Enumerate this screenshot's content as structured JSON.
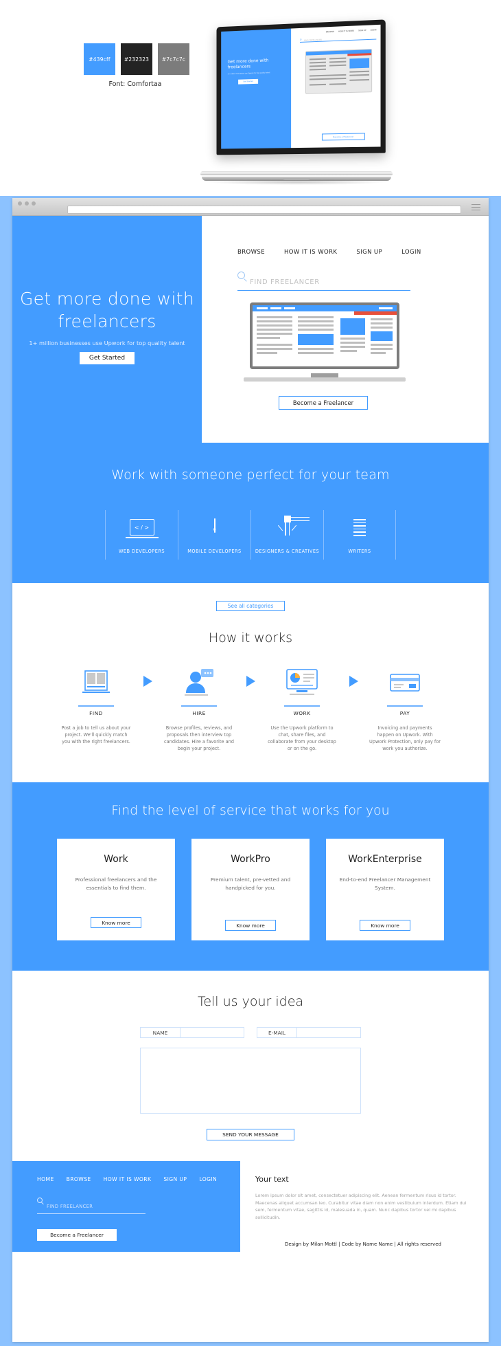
{
  "brand": {
    "swatches": [
      {
        "hex": "#439cff",
        "label": "#439cff",
        "text_color": "#ffffff"
      },
      {
        "hex": "#232323",
        "label": "#232323",
        "text_color": "#ffffff"
      },
      {
        "hex": "#7c7c7c",
        "label": "#7c7c7c",
        "text_color": "#ffffff"
      }
    ],
    "font_note": "Font: Comfortaa"
  },
  "mockup": {
    "nav": [
      "BROWSE",
      "HOW IT IS WORK",
      "SIGN UP",
      "LOGIN"
    ],
    "search_placeholder": "FIND FREELANCER",
    "headline": "Get more done with freelancers",
    "subhead": "1+ million businesses use Upwork for top quality talent",
    "cta": "Get Started",
    "become": "Become a Freelancer"
  },
  "browser": {
    "url_value": ""
  },
  "hero": {
    "nav": [
      "BROWSE",
      "HOW IT IS WORK",
      "SIGN UP",
      "LOGIN"
    ],
    "search_placeholder": "FIND FREELANCER",
    "headline": "Get more done with freelancers",
    "subhead": "1+ million businesses use Upwork for top quality talent",
    "cta": "Get Started",
    "become_freelancer": "Become a Freelancer"
  },
  "categories": {
    "title": "Work with someone perfect for your team",
    "items": [
      {
        "label": "WEB DEVELOPERS",
        "icon": "laptop-code-icon"
      },
      {
        "label": "MOBILE DEVELOPERS",
        "icon": "mobile-phone-icon"
      },
      {
        "label": "DESIGNERS & CREATIVES",
        "icon": "vector-nodes-icon"
      },
      {
        "label": "WRITERS",
        "icon": "document-lines-icon"
      }
    ],
    "see_all": "See all categories"
  },
  "how_it_works": {
    "title": "How it works",
    "steps": [
      {
        "name": "FIND",
        "icon": "job-post-icon",
        "desc": "Post a job to tell us about your project. We'll quickly match you with the right freelancers."
      },
      {
        "name": "HIRE",
        "icon": "profile-chat-icon",
        "desc": "Browse profiles, reviews, and proposals then interview top candidates. Hire a favorite and begin your project."
      },
      {
        "name": "WORK",
        "icon": "monitor-dashboard-icon",
        "desc": "Use the Upwork platform to chat, share files, and collaborate from your desktop or on the go."
      },
      {
        "name": "PAY",
        "icon": "credit-card-icon",
        "desc": "Invoicing and payments happen on Upwork. With Upwork Protection, only pay for work you authorize."
      }
    ]
  },
  "levels": {
    "title": "Find the level of service that works for you",
    "cards": [
      {
        "name": "Work",
        "desc": "Professional freelancers and the essentials to find them.",
        "button": "Know more"
      },
      {
        "name": "WorkPro",
        "desc": "Premium talent, pre-vetted and handpicked for you.",
        "button": "Know more"
      },
      {
        "name": "WorkEnterprise",
        "desc": "End-to-end Freelancer Management System.",
        "button": "Know more"
      }
    ]
  },
  "contact": {
    "title": "Tell us your idea",
    "name_label": "NAME",
    "name_value": "",
    "email_label": "E-MAIL",
    "email_value": "",
    "message_value": "",
    "send_button": "SEND YOUR MESSAGE"
  },
  "footer": {
    "nav": [
      "HOME",
      "BROWSE",
      "HOW IT IS WORK",
      "SIGN UP",
      "LOGIN"
    ],
    "search_placeholder": "FIND FREELANCER",
    "become_freelancer": "Become a Freelancer",
    "right_title": "Your text",
    "right_text": "Lorem ipsum dolor sit amet, consectetuer adipiscing elit. Aenean fermentum risus id tortor. Maecenas aliquet accumsan leo. Curabitur vitae diam non enim vestibulum interdum. Etiam dui sem, fermentum vitae, sagittis id, malesuada in, quam. Nunc dapibus tortor vel mi dapibus sollicitudin.",
    "credit": "Design by Milan Mottl | Code by Name Name | All rights reserved"
  }
}
